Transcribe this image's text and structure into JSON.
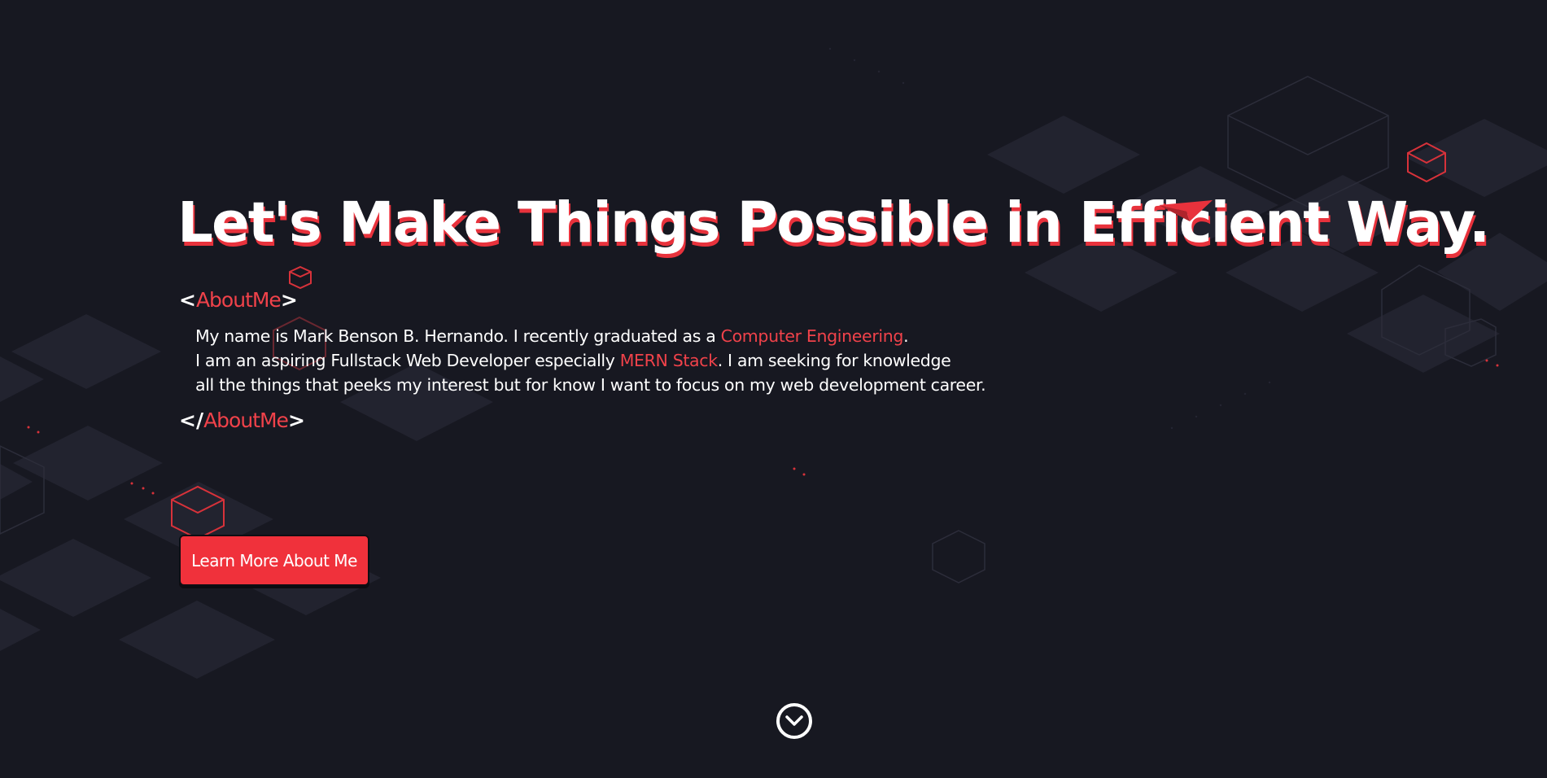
{
  "hero": {
    "headline": "Let's Make Things Possible in Efficient Way."
  },
  "about": {
    "open_bracket": "<",
    "close_bracket_open": "</",
    "bracket_end": ">",
    "tag_name": "AboutMe",
    "line1_before": "My name is Mark Benson B. Hernando. I recently graduated as a ",
    "line1_highlight": "Computer Engineering",
    "line1_after": ".",
    "line2_before": "I am an aspiring Fullstack Web Developer especially ",
    "line2_highlight": "MERN Stack",
    "line2_after": ". I am seeking for knowledge",
    "line3": "all the things that peeks my interest but for know I want to focus on my web development career."
  },
  "cta": {
    "label": "Learn More About Me"
  },
  "icons": {
    "scroll": "chevron-down-circle-icon",
    "plane": "paper-plane-icon",
    "decor": "isometric-cube-icon"
  },
  "colors": {
    "background": "#171821",
    "tile": "#22232f",
    "accent": "#f0313b",
    "text": "#ffffff"
  }
}
